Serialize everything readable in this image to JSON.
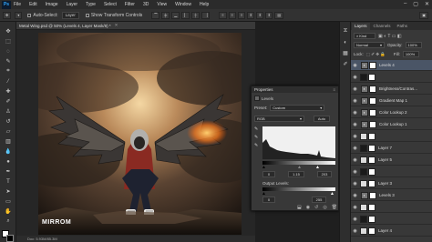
{
  "app": {
    "logo": "Ps"
  },
  "menu": [
    "File",
    "Edit",
    "Image",
    "Layer",
    "Type",
    "Select",
    "Filter",
    "3D",
    "View",
    "Window",
    "Help"
  ],
  "window_controls": [
    "‒",
    "▢",
    "✕"
  ],
  "options_bar": {
    "auto_select_label": "Auto-Select:",
    "auto_select_value": "Layer",
    "transform_label": "Show Transform Controls"
  },
  "document": {
    "tab_title": "Metal Wing.psd @ 50% (Levels 4, Layer Mask/8) *",
    "status": "Doc: 5.93M/85.3M"
  },
  "watermark": "MIRROM",
  "properties": {
    "panel_title": "Properties",
    "type_label": "Levels",
    "preset_label": "Preset:",
    "preset_value": "Custom",
    "channel_value": "RGB",
    "auto_label": "Auto",
    "input_values": [
      "0",
      "1.15",
      "203"
    ],
    "output_label": "Output Levels:",
    "output_values": [
      "0",
      "255"
    ]
  },
  "layers_panel": {
    "tabs": [
      "Layers",
      "Channels",
      "Paths"
    ],
    "kind_label": "Kind",
    "blend_mode": "Normal",
    "opacity_label": "Opacity:",
    "opacity_value": "100%",
    "lock_label": "Lock:",
    "fill_label": "Fill:",
    "fill_value": "100%",
    "layers": [
      {
        "name": "Levels 4",
        "selected": true,
        "type": "adj"
      },
      {
        "name": "",
        "selected": false,
        "type": "pix"
      },
      {
        "name": "Brightness/Contras...",
        "selected": false,
        "type": "adj"
      },
      {
        "name": "Gradient Map 1",
        "selected": false,
        "type": "adj"
      },
      {
        "name": "Color Lookup 2",
        "selected": false,
        "type": "adj"
      },
      {
        "name": "Color Lookup 1",
        "selected": false,
        "type": "adj"
      },
      {
        "name": "",
        "selected": false,
        "type": "pix"
      },
      {
        "name": "Layer 7",
        "selected": false,
        "type": "pix"
      },
      {
        "name": "Layer 5",
        "selected": false,
        "type": "pix"
      },
      {
        "name": "",
        "selected": false,
        "type": "pix"
      },
      {
        "name": "Layer 3",
        "selected": false,
        "type": "pix"
      },
      {
        "name": "Levels 3",
        "selected": false,
        "type": "adj"
      },
      {
        "name": "",
        "selected": false,
        "type": "pix"
      },
      {
        "name": "",
        "selected": false,
        "type": "pix"
      },
      {
        "name": "Layer 4",
        "selected": false,
        "type": "pix"
      }
    ]
  }
}
